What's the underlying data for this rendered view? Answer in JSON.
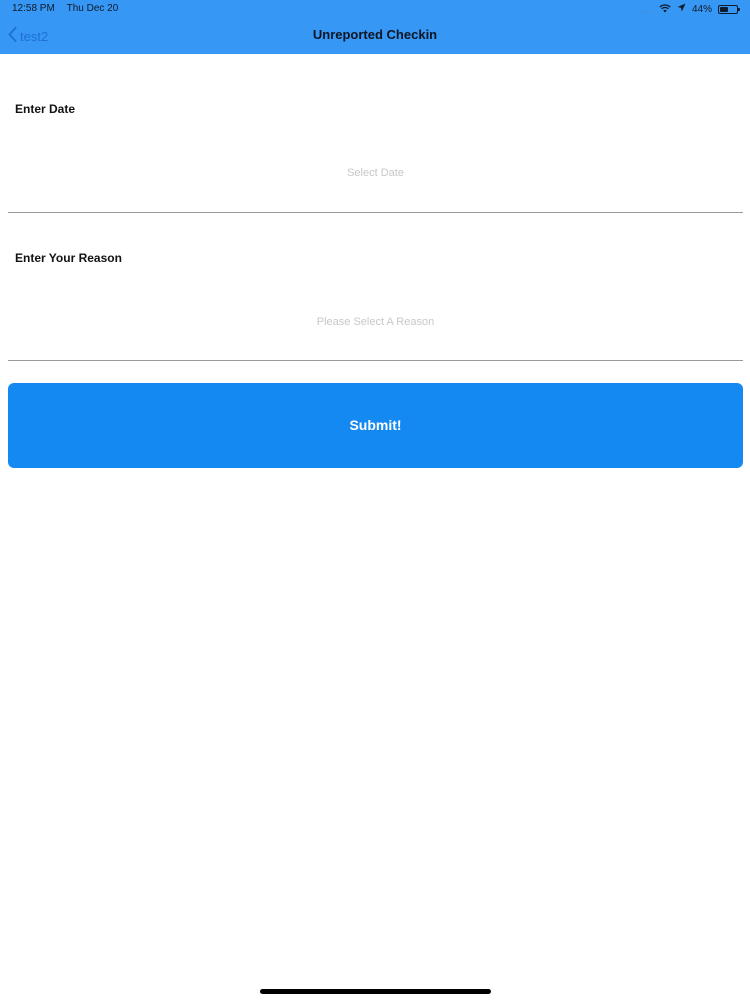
{
  "status_bar": {
    "time": "12:58 PM",
    "date": "Thu Dec 20",
    "signal_dots": "....",
    "battery_percent_label": "44%",
    "battery_level": 0.44,
    "icons": [
      "wifi-icon",
      "location-arrow-icon",
      "battery-icon"
    ]
  },
  "nav": {
    "back_label": "test2",
    "title": "Unreported Checkin",
    "back_icon": "chevron-left-icon"
  },
  "form": {
    "date": {
      "label": "Enter Date",
      "placeholder": "Select Date"
    },
    "reason": {
      "label": "Enter Your Reason",
      "placeholder": "Please Select A Reason"
    },
    "submit_label": "Submit!"
  },
  "colors": {
    "nav_background": "#3797f4",
    "back_link": "#1f6fd9",
    "submit_background": "#1589f2",
    "placeholder_text": "#c7c7c7",
    "divider": "#9a9a9a"
  }
}
